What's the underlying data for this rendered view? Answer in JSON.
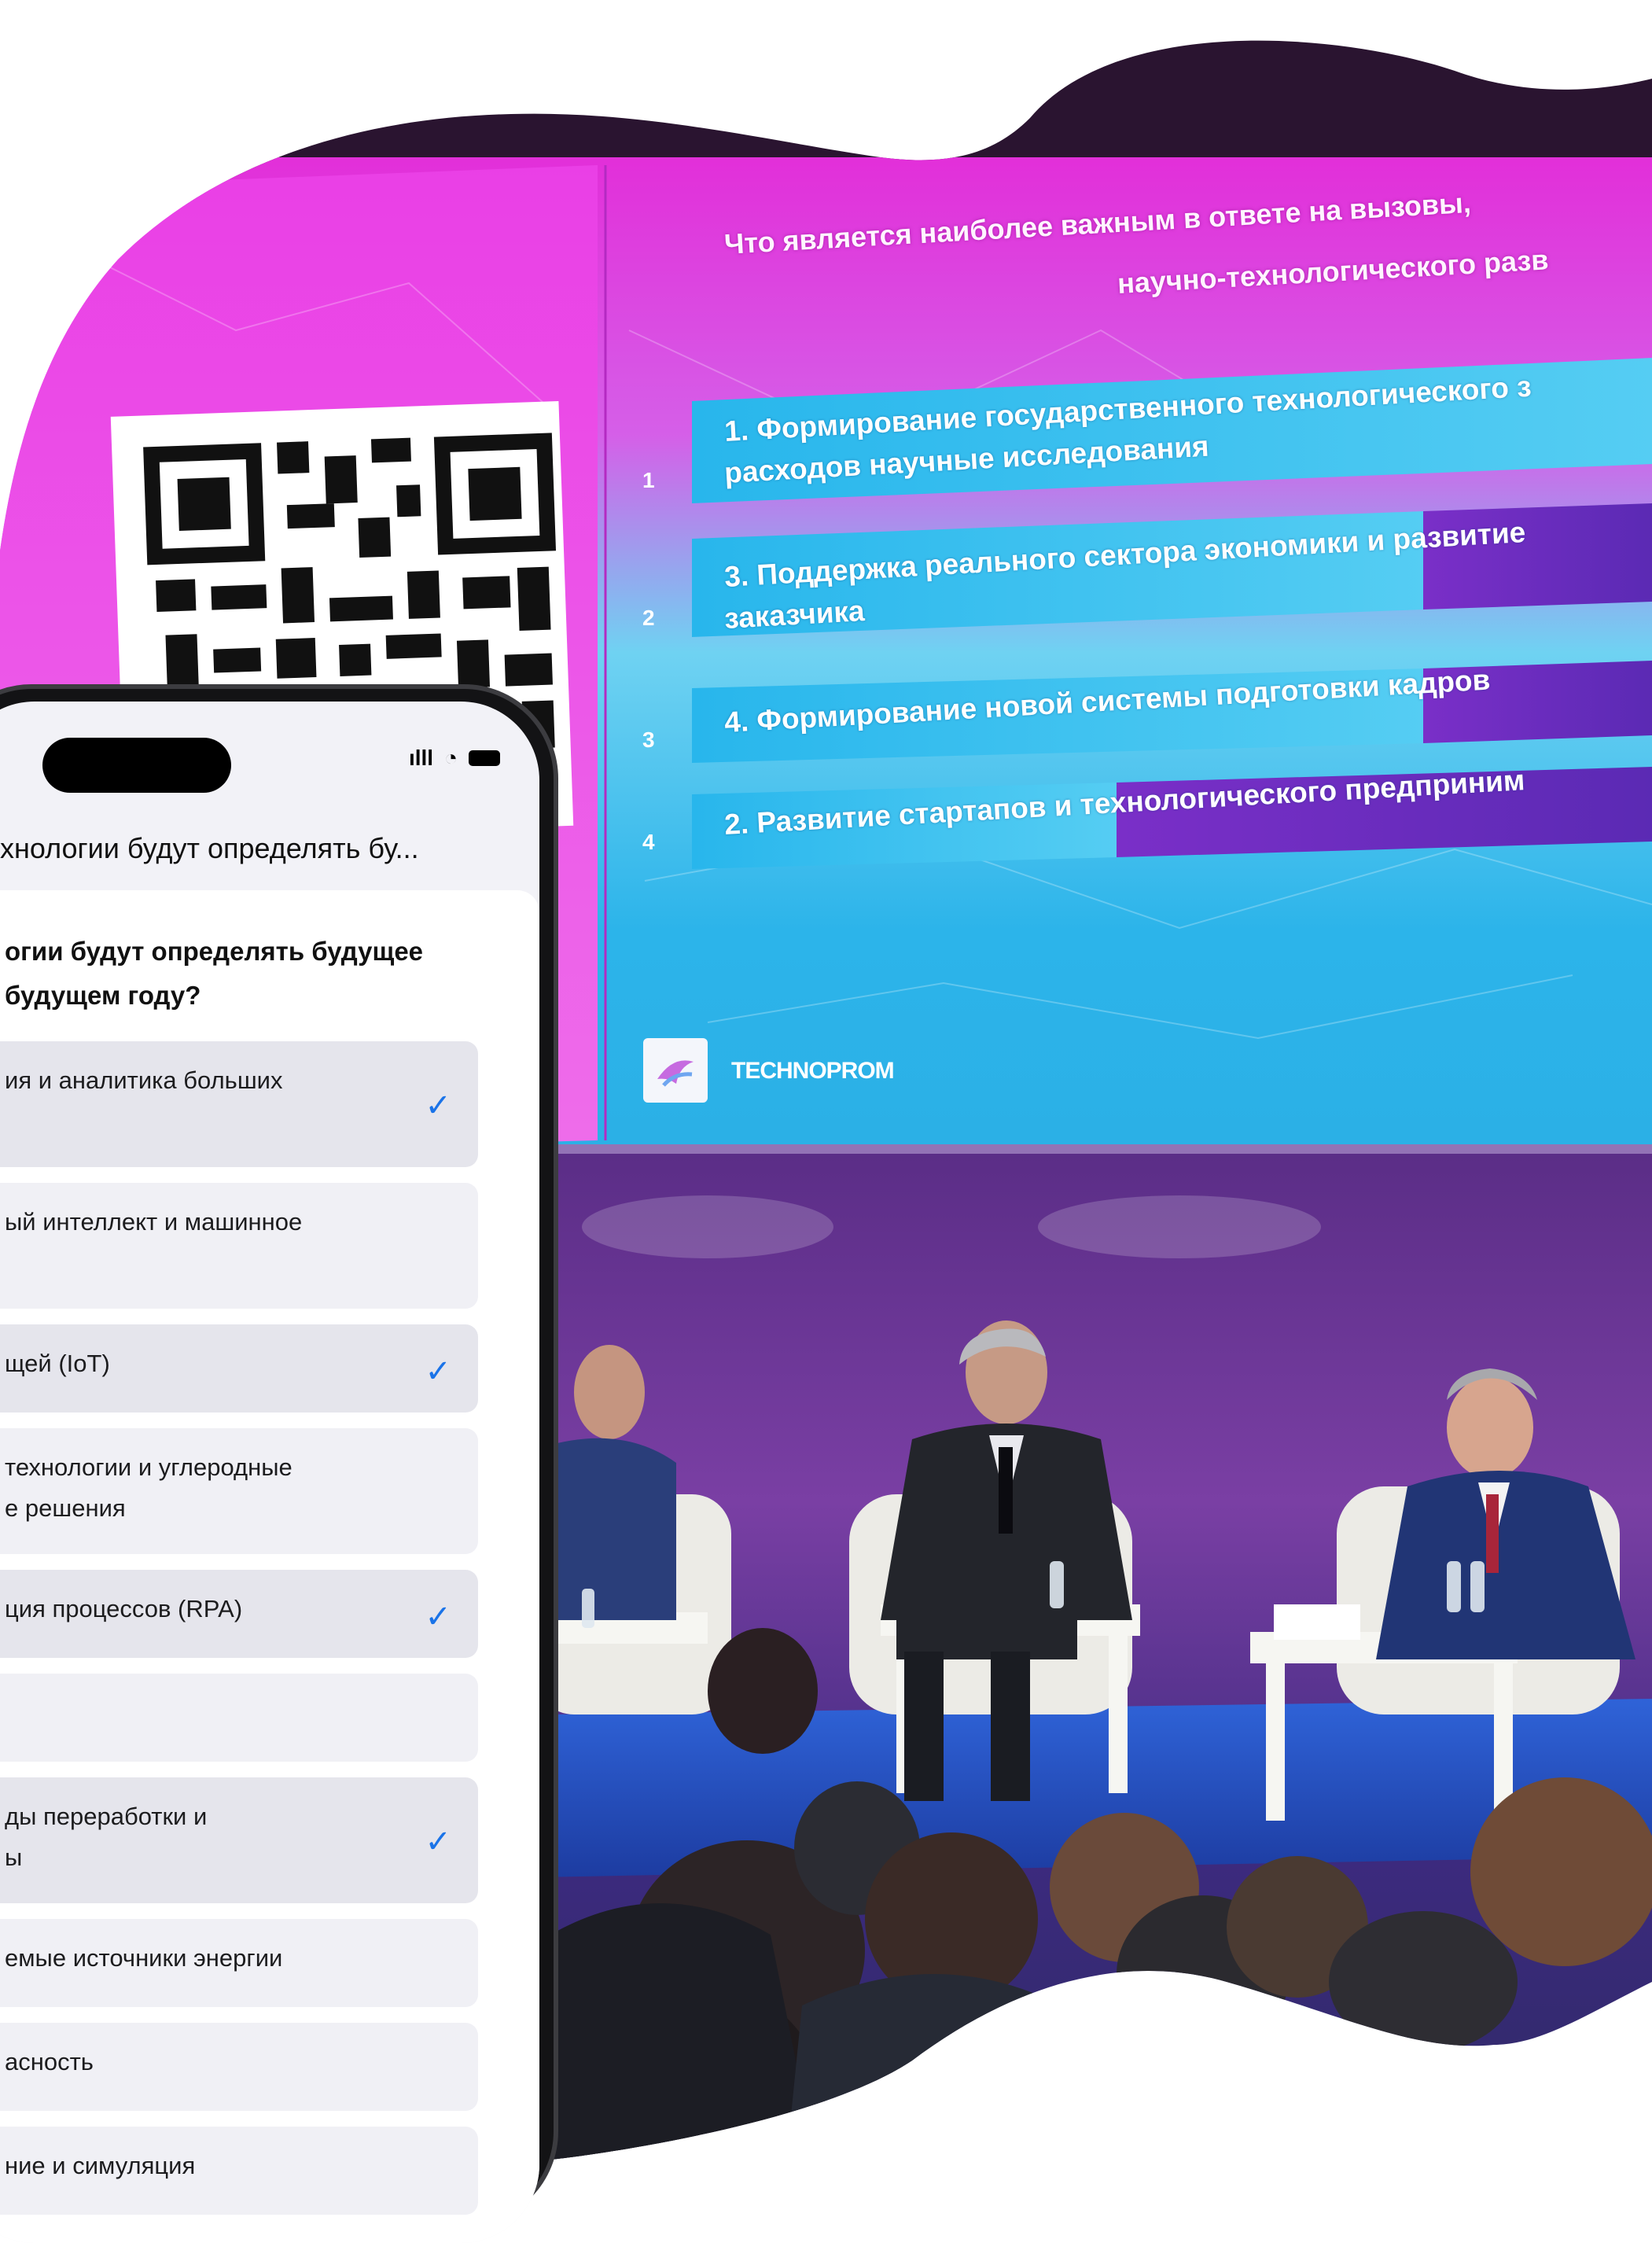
{
  "presentation": {
    "question_line1": "Что является наиболее важным в ответе на вызовы,",
    "question_line2": "научно-технологического разв",
    "rows": [
      {
        "num": "1",
        "line1": "1. Формирование государственного технологического з",
        "line2": "расходов научные исследования"
      },
      {
        "num": "2",
        "line1": "3. Поддержка реального сектора экономики и развитие",
        "line2": "заказчика"
      },
      {
        "num": "3",
        "line1": "4. Формирование новой системы подготовки кадров",
        "line2": ""
      },
      {
        "num": "4",
        "line1": "2. Развитие стартапов и технологического предприним",
        "line2": ""
      }
    ],
    "brand": "TECHNOPROM",
    "accent_magenta": "#e83ee8",
    "accent_cyan": "#25b8e6",
    "accent_violet": "#6c2bbf"
  },
  "phone": {
    "nav_title": "хнологии будут определять бу...",
    "question": "огии будут определять будущее будущем году?",
    "question_line1": "огии будут определять будущее",
    "question_line2": "будущем году?",
    "options": [
      {
        "line1": "ия и аналитика больших",
        "line2": "",
        "selected": true
      },
      {
        "line1": "ый интеллект и машинное",
        "line2": "",
        "selected": false
      },
      {
        "line1": "щей (IoT)",
        "line2": "",
        "selected": true
      },
      {
        "line1": "технологии и углеродные",
        "line2": "е решения",
        "selected": false
      },
      {
        "line1": "ция процессов (RPA)",
        "line2": "",
        "selected": true
      },
      {
        "line1": "",
        "line2": "",
        "selected": false
      },
      {
        "line1": "ды переработки и",
        "line2": "ы",
        "selected": true
      },
      {
        "line1": "емые источники энергии",
        "line2": "",
        "selected": false
      },
      {
        "line1": "асность",
        "line2": "",
        "selected": false
      },
      {
        "line1": "ние и симуляция",
        "line2": "",
        "selected": false
      }
    ],
    "check_icon": "✓",
    "check_color": "#1a73e8"
  }
}
